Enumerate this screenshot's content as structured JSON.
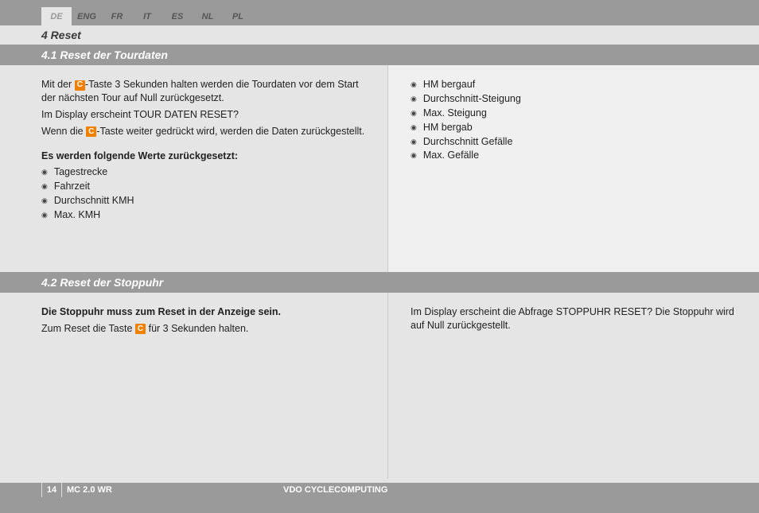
{
  "languages": [
    "DE",
    "ENG",
    "FR",
    "IT",
    "ES",
    "NL",
    "PL"
  ],
  "active_lang_index": 0,
  "chapter": "4 Reset",
  "section1": {
    "title": "4.1 Reset der Tourdaten",
    "left": {
      "p1a": "Mit der ",
      "p1b": "-Taste 3 Sekunden halten werden die Tourdaten vor dem Start der nächsten Tour auf Null zurückgesetzt.",
      "p2": "Im Display erscheint TOUR DATEN RESET?",
      "p3a": "Wenn die ",
      "p3b": "-Taste weiter gedrückt wird, werden die Daten zurückgestellt.",
      "bold": "Es werden folgende Werte zurückgesetzt:",
      "items": [
        "Tagestrecke",
        "Fahrzeit",
        "Durchschnitt KMH",
        "Max. KMH"
      ]
    },
    "right": {
      "items": [
        "HM bergauf",
        "Durchschnitt-Steigung",
        "Max. Steigung",
        "HM bergab",
        "Durchschnitt Gefälle",
        "Max. Gefälle"
      ]
    }
  },
  "section2": {
    "title": "4.2 Reset der Stoppuhr",
    "left": {
      "bold": "Die Stoppuhr muss zum Reset in der Anzeige sein.",
      "p1a": "Zum Reset die Taste ",
      "p1b": " für 3 Sekunden halten."
    },
    "right": {
      "p1": "Im Display erscheint die Abfrage STOPPUHR RESET? Die Stoppuhr wird auf Null zurückgestellt."
    }
  },
  "key_label": "C",
  "footer": {
    "page": "14",
    "model": "MC 2.0 WR",
    "brand": "VDO CYCLECOMPUTING"
  }
}
